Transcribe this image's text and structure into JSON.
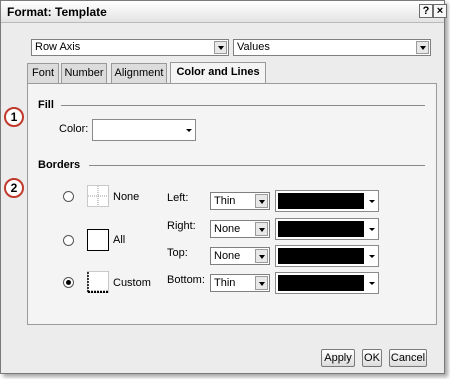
{
  "dialog": {
    "title": "Format: Template",
    "help_label": "?",
    "close_label": "×"
  },
  "axis_select": {
    "value": "Row Axis"
  },
  "values_select": {
    "value": "Values"
  },
  "tabs": [
    {
      "label": "Font"
    },
    {
      "label": "Number"
    },
    {
      "label": "Alignment"
    },
    {
      "label": "Color and Lines",
      "active": true
    }
  ],
  "fill": {
    "title": "Fill",
    "color_label": "Color:",
    "marker": "1"
  },
  "borders": {
    "title": "Borders",
    "marker": "2",
    "options": [
      {
        "label": "None",
        "checked": false
      },
      {
        "label": "All",
        "checked": false
      },
      {
        "label": "Custom",
        "checked": true
      }
    ],
    "sides": [
      {
        "label": "Left:",
        "style": "Thin",
        "color": "#000000"
      },
      {
        "label": "Right:",
        "style": "None",
        "color": "#000000"
      },
      {
        "label": "Top:",
        "style": "None",
        "color": "#000000"
      },
      {
        "label": "Bottom:",
        "style": "Thin",
        "color": "#000000"
      }
    ]
  },
  "buttons": {
    "apply": "Apply",
    "ok": "OK",
    "cancel": "Cancel"
  },
  "colors": {
    "marker_border": "#c0392b",
    "dialog_bg": "#ececec"
  }
}
